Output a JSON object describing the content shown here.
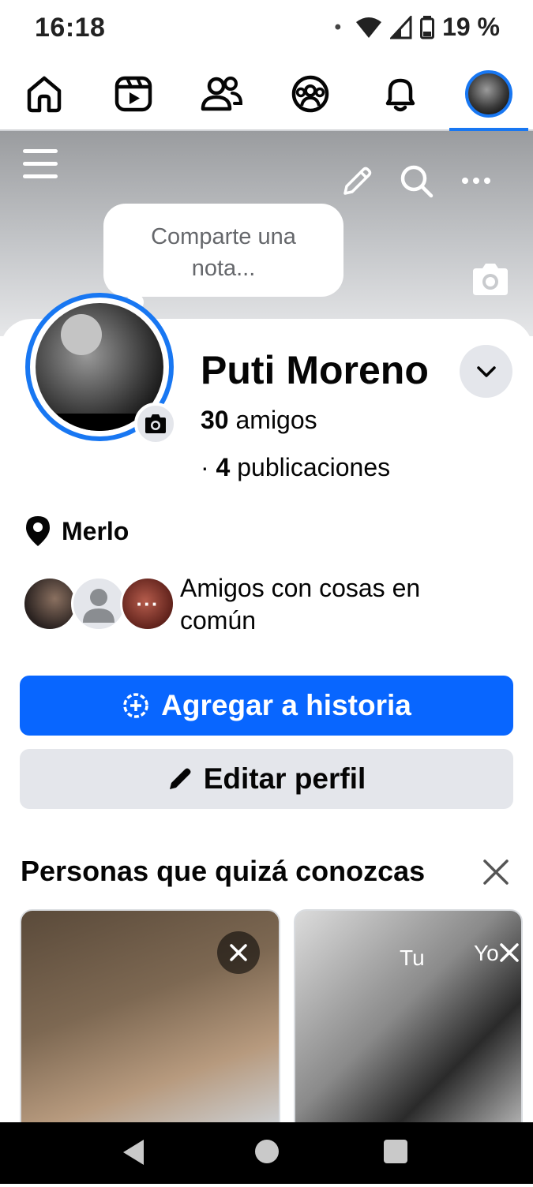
{
  "status": {
    "time": "16:18",
    "dot": "•",
    "battery": "19 %"
  },
  "nav": {
    "items": [
      {
        "name": "home",
        "icon": "home-icon"
      },
      {
        "name": "video",
        "icon": "video-icon"
      },
      {
        "name": "friends",
        "icon": "friends-icon"
      },
      {
        "name": "groups",
        "icon": "groups-icon"
      },
      {
        "name": "notifications",
        "icon": "bell-icon"
      },
      {
        "name": "profile",
        "icon": "avatar"
      }
    ],
    "active": "profile"
  },
  "cover": {
    "note_text": "Comparte una nota..."
  },
  "profile": {
    "name": "Puti Moreno",
    "friends_count": "30",
    "friends_label": "amigos",
    "posts_prefix": "·",
    "posts_count": "4",
    "posts_label": "publicaciones",
    "location": "Merlo",
    "mutual_text": "Amigos con cosas en común"
  },
  "buttons": {
    "add_story": "Agregar a historia",
    "edit_profile": "Editar perfil"
  },
  "pymk": {
    "title": "Personas que quizá conozcas",
    "cards": [
      {
        "overlay": ""
      },
      {
        "overlay_left": "Tu",
        "overlay_right": "Yo"
      }
    ]
  },
  "colors": {
    "accent": "#0866ff",
    "ring": "#1877f2",
    "secondary": "#e4e6eb"
  }
}
